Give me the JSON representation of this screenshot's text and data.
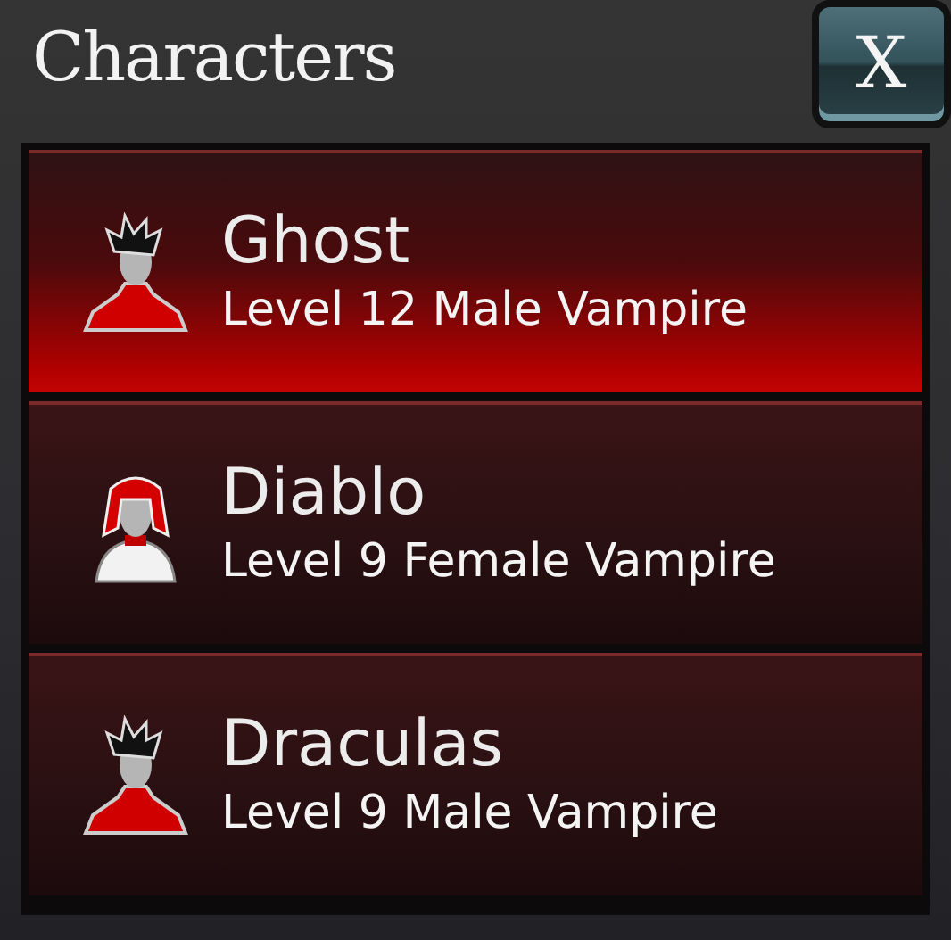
{
  "window": {
    "title": "Characters",
    "close_label": "X"
  },
  "characters": [
    {
      "name": "Ghost",
      "description": "Level 12 Male Vampire",
      "kind": "male",
      "selected": true
    },
    {
      "name": "Diablo",
      "description": "Level 9 Female Vampire",
      "kind": "female",
      "selected": false
    },
    {
      "name": "Draculas",
      "description": "Level 9 Male Vampire",
      "kind": "male",
      "selected": false
    }
  ]
}
